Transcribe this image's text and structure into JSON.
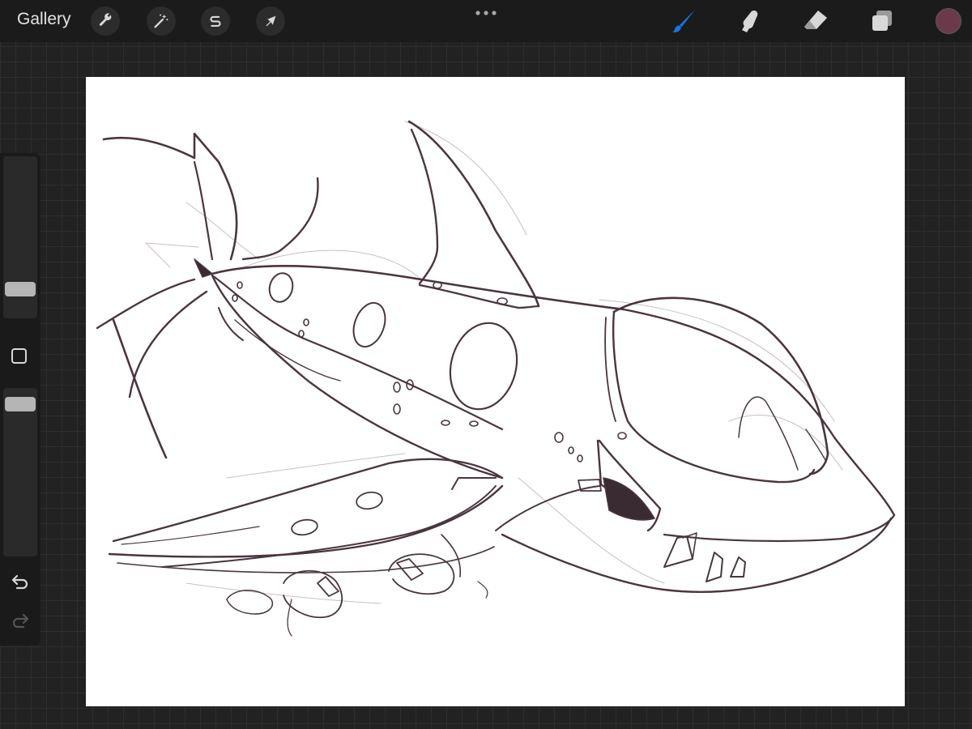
{
  "topbar": {
    "gallery_label": "Gallery",
    "left_tools": [
      "actions-wrench-icon",
      "adjustments-wand-icon",
      "selection-s-icon",
      "transform-arrow-icon"
    ],
    "right_tools": [
      "brush-icon",
      "smudge-icon",
      "eraser-icon",
      "layers-icon"
    ],
    "active_tool": "brush",
    "accent_color": "#1a73e8",
    "current_color": "#6b3a4a"
  },
  "sidebar": {
    "brush_size_level": 0.16,
    "opacity_level": 0.9,
    "icons": [
      "modify-square-icon",
      "undo-icon",
      "redo-icon"
    ]
  },
  "canvas": {
    "background": "#ffffff",
    "stroke_color": "#4a3540",
    "subject": "shark-submarine-sketch"
  }
}
